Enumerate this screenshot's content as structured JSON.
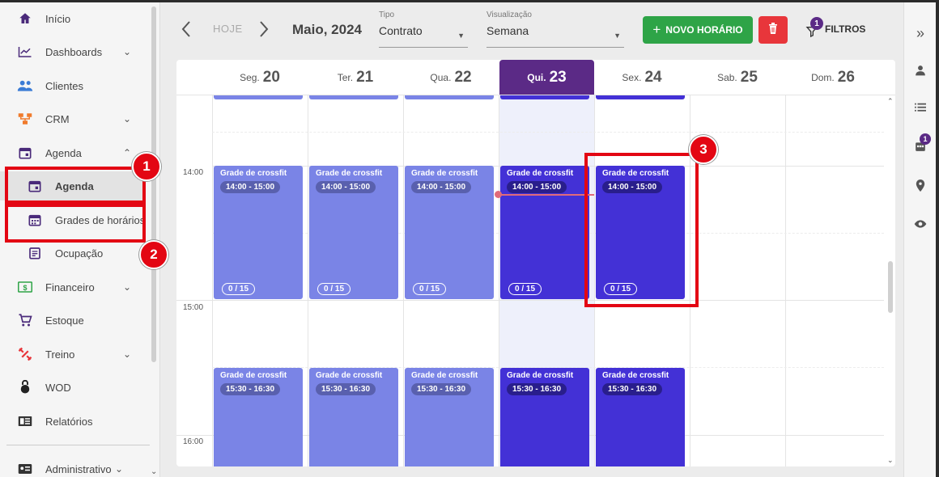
{
  "sidebar": {
    "items": [
      {
        "label": "Início",
        "icon": "home-icon",
        "chevron": ""
      },
      {
        "label": "Dashboards",
        "icon": "chart-line-icon",
        "chevron": "⌄"
      },
      {
        "label": "Clientes",
        "icon": "people-icon",
        "chevron": ""
      },
      {
        "label": "CRM",
        "icon": "crm-icon",
        "chevron": "⌄"
      },
      {
        "label": "Agenda",
        "icon": "calendar-icon",
        "chevron": "⌃"
      },
      {
        "label": "Agenda",
        "icon": "calendar-icon",
        "chevron": ""
      },
      {
        "label": "Grades de horários",
        "icon": "calendar-grid-icon",
        "chevron": ""
      },
      {
        "label": "Ocupação",
        "icon": "list-icon",
        "chevron": ""
      },
      {
        "label": "Financeiro",
        "icon": "money-icon",
        "chevron": "⌄"
      },
      {
        "label": "Estoque",
        "icon": "cart-icon",
        "chevron": ""
      },
      {
        "label": "Treino",
        "icon": "dumbbell-icon",
        "chevron": "⌄"
      },
      {
        "label": "WOD",
        "icon": "kettlebell-icon",
        "chevron": ""
      },
      {
        "label": "Relatórios",
        "icon": "report-icon",
        "chevron": ""
      },
      {
        "label": "Administrativo",
        "icon": "id-card-icon",
        "chevron": "⌄"
      }
    ]
  },
  "annotations": [
    "1",
    "2",
    "3"
  ],
  "toolbar": {
    "today_label": "HOJE",
    "month_label": "Maio, 2024",
    "tipo": {
      "label": "Tipo",
      "value": "Contrato"
    },
    "visualizacao": {
      "label": "Visualização",
      "value": "Semana"
    },
    "new_button": "NOVO HORÁRIO",
    "filters_label": "FILTROS",
    "filters_badge": "1"
  },
  "calendar": {
    "days": [
      {
        "name": "Seg.",
        "num": "20"
      },
      {
        "name": "Ter.",
        "num": "21"
      },
      {
        "name": "Qua.",
        "num": "22"
      },
      {
        "name": "Qui.",
        "num": "23"
      },
      {
        "name": "Sex.",
        "num": "24"
      },
      {
        "name": "Sab.",
        "num": "25"
      },
      {
        "name": "Dom.",
        "num": "26"
      }
    ],
    "time_labels": [
      "14:00",
      "15:00",
      "16:00"
    ],
    "event_title": "Grade de crossfit",
    "slot1_time": "14:00 - 15:00",
    "slot2_time": "15:30 - 16:30",
    "capacity": "0 / 15",
    "colors": {
      "past": "#7a84e6",
      "current": "#4331d6",
      "today_header": "#5b2a86"
    }
  },
  "right_rail": {
    "badge": "1"
  }
}
